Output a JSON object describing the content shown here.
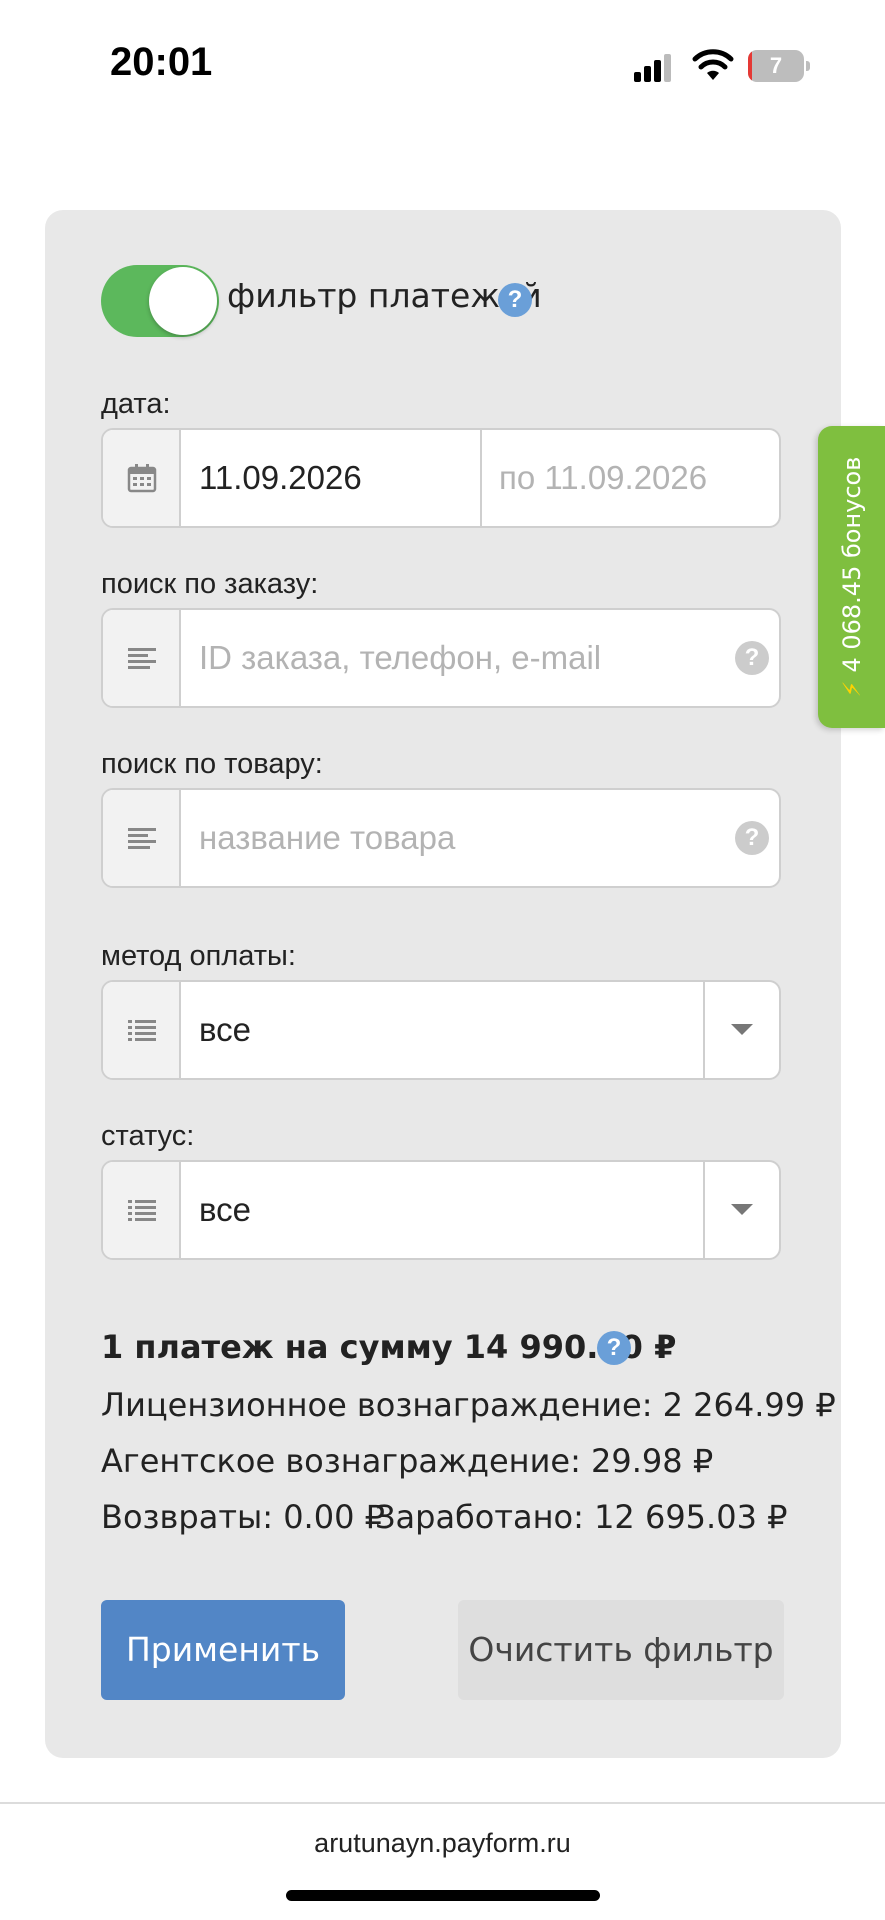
{
  "status_bar": {
    "time": "20:01",
    "battery_level_text": "7",
    "battery_level_percent": 7,
    "icons": [
      "signal-icon",
      "wifi-icon",
      "battery-icon"
    ]
  },
  "filter": {
    "toggle_on": true,
    "toggle_label": "фильтр платежей",
    "help_glyph": "?",
    "date": {
      "label": "дата:",
      "from_value": "11.09.2026",
      "to_placeholder": "по 11.09.2026",
      "icon": "calendar-icon"
    },
    "order_search": {
      "label": "поиск по заказу:",
      "placeholder": "ID заказа, телефон, e-mail",
      "icon": "text-lines-icon"
    },
    "product_search": {
      "label": "поиск по товару:",
      "placeholder": "название товара",
      "icon": "text-lines-icon"
    },
    "payment_method": {
      "label": "метод оплаты:",
      "selected": "все",
      "icon": "list-icon"
    },
    "status": {
      "label": "статус:",
      "selected": "все",
      "icon": "list-icon"
    }
  },
  "summary": {
    "headline": "1 платеж на сумму 14 990.00 ₽",
    "license_fee": "Лицензионное вознаграждение: 2 264.99 ₽",
    "agent_fee": "Агентское вознаграждение: 29.98 ₽",
    "refunds": "Возвраты: 0.00 ₽",
    "earned": "Заработано: 12 695.03 ₽"
  },
  "actions": {
    "apply_label": "Применить",
    "clear_label": "Очистить фильтр"
  },
  "bonus_tab": {
    "text": "4 068.45 бонусов",
    "icon": "lightning-icon"
  },
  "footer": {
    "url": "arutunayn.payform.ru"
  },
  "colors": {
    "toggle_green": "#5cb85c",
    "apply_blue": "#5286c6",
    "bonus_green": "#7fbf3f",
    "help_blue": "#6a9fd8",
    "card_bg": "#e8e8e8"
  }
}
